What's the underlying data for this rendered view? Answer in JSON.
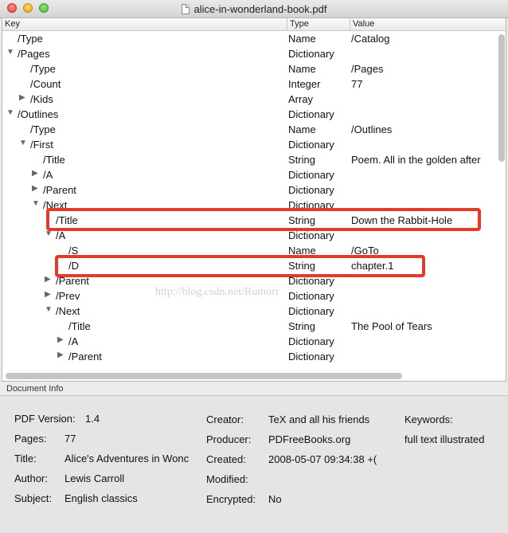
{
  "window": {
    "title": "alice-in-wonderland-book.pdf"
  },
  "table": {
    "columns": [
      "Key",
      "Type",
      "Value"
    ],
    "rows": [
      {
        "key": "/Type",
        "type": "Name",
        "value": "/Catalog",
        "depth": 0,
        "toggle": "none"
      },
      {
        "key": "/Pages",
        "type": "Dictionary",
        "value": "",
        "depth": 0,
        "toggle": "open"
      },
      {
        "key": "/Type",
        "type": "Name",
        "value": "/Pages",
        "depth": 1,
        "toggle": "none"
      },
      {
        "key": "/Count",
        "type": "Integer",
        "value": "77",
        "depth": 1,
        "toggle": "none"
      },
      {
        "key": "/Kids",
        "type": "Array",
        "value": "",
        "depth": 1,
        "toggle": "closed"
      },
      {
        "key": "/Outlines",
        "type": "Dictionary",
        "value": "",
        "depth": 0,
        "toggle": "open"
      },
      {
        "key": "/Type",
        "type": "Name",
        "value": "/Outlines",
        "depth": 1,
        "toggle": "none"
      },
      {
        "key": "/First",
        "type": "Dictionary",
        "value": "",
        "depth": 1,
        "toggle": "open"
      },
      {
        "key": "/Title",
        "type": "String",
        "value": "Poem. All in the golden after",
        "depth": 2,
        "toggle": "none"
      },
      {
        "key": "/A",
        "type": "Dictionary",
        "value": "",
        "depth": 2,
        "toggle": "closed"
      },
      {
        "key": "/Parent",
        "type": "Dictionary",
        "value": "",
        "depth": 2,
        "toggle": "closed"
      },
      {
        "key": "/Next",
        "type": "Dictionary",
        "value": "",
        "depth": 2,
        "toggle": "open"
      },
      {
        "key": "/Title",
        "type": "String",
        "value": "Down the Rabbit-Hole",
        "depth": 3,
        "toggle": "none"
      },
      {
        "key": "/A",
        "type": "Dictionary",
        "value": "",
        "depth": 3,
        "toggle": "open"
      },
      {
        "key": "/S",
        "type": "Name",
        "value": "/GoTo",
        "depth": 4,
        "toggle": "none"
      },
      {
        "key": "/D",
        "type": "String",
        "value": "chapter.1",
        "depth": 4,
        "toggle": "none"
      },
      {
        "key": "/Parent",
        "type": "Dictionary",
        "value": "",
        "depth": 3,
        "toggle": "closed"
      },
      {
        "key": "/Prev",
        "type": "Dictionary",
        "value": "",
        "depth": 3,
        "toggle": "closed"
      },
      {
        "key": "/Next",
        "type": "Dictionary",
        "value": "",
        "depth": 3,
        "toggle": "open"
      },
      {
        "key": "/Title",
        "type": "String",
        "value": "The Pool of Tears",
        "depth": 4,
        "toggle": "none"
      },
      {
        "key": "/A",
        "type": "Dictionary",
        "value": "",
        "depth": 4,
        "toggle": "closed"
      },
      {
        "key": "/Parent",
        "type": "Dictionary",
        "value": "",
        "depth": 4,
        "toggle": "closed"
      }
    ],
    "highlighted_rows": [
      12,
      15
    ],
    "watermark": "http://blog.csdn.net/Rumorr"
  },
  "doc_info": {
    "section_label": "Document Info",
    "pdf_version_label": "PDF Version:",
    "pdf_version": "1.4",
    "pages_label": "Pages:",
    "pages": "77",
    "title_label": "Title:",
    "title": "Alice's Adventures in Wonc",
    "author_label": "Author:",
    "author": "Lewis Carroll",
    "subject_label": "Subject:",
    "subject": "English classics",
    "creator_label": "Creator:",
    "creator": "TeX and all his friends",
    "producer_label": "Producer:",
    "producer": "PDFreeBooks.org",
    "created_label": "Created:",
    "created": "2008-05-07 09:34:38 +(",
    "modified_label": "Modified:",
    "modified": "",
    "encrypted_label": "Encrypted:",
    "encrypted": "No",
    "keywords_label": "Keywords:",
    "keywords": "full text illustrated"
  },
  "colors": {
    "highlight": "#e63a28"
  }
}
